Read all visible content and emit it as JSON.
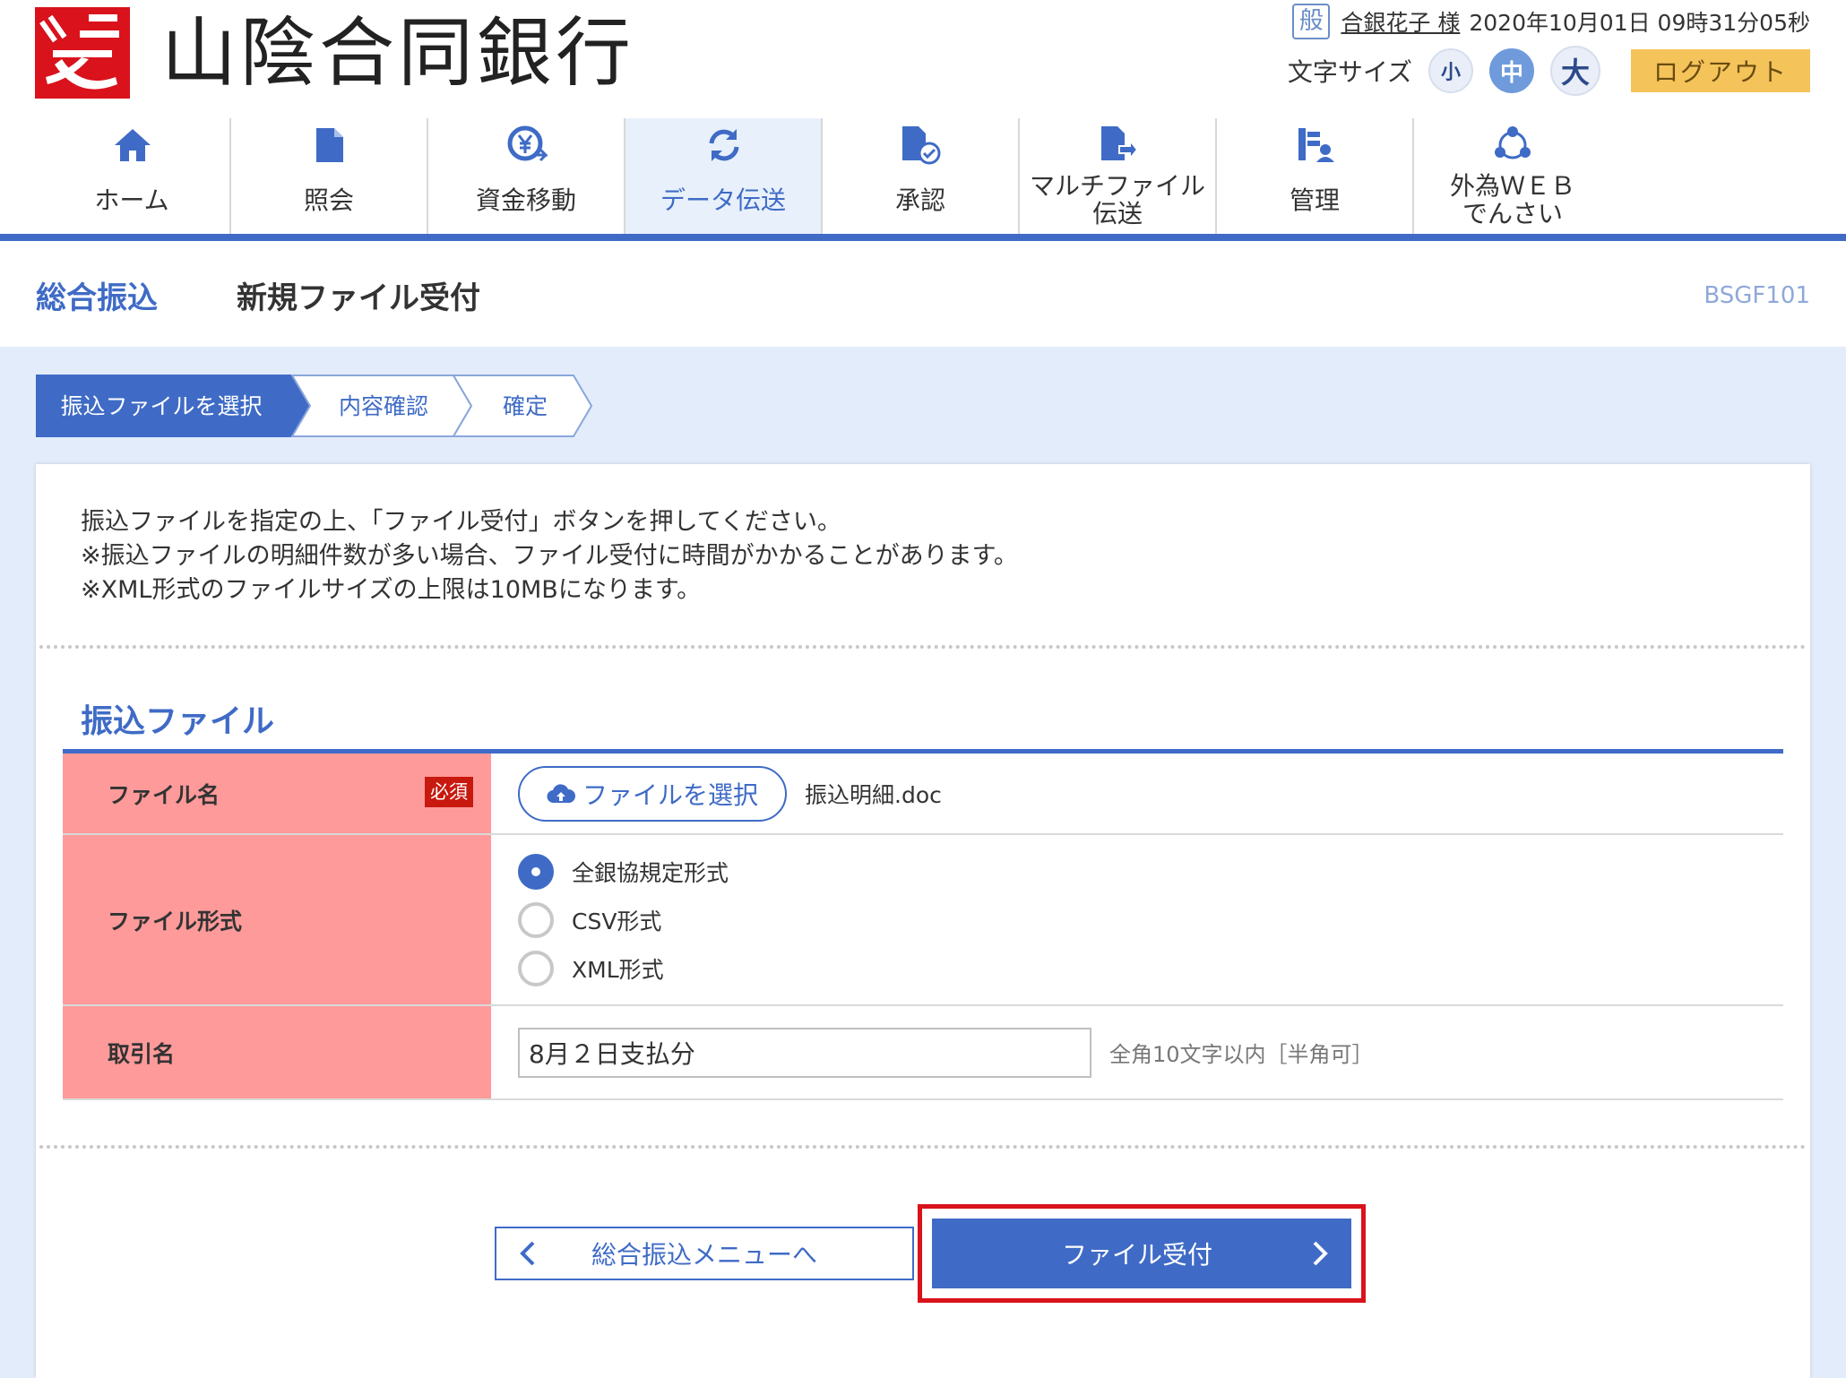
{
  "header": {
    "bank_name": "山陰合同銀行",
    "user_badge": "般",
    "user_name": "合銀花子 様",
    "datetime": "2020年10月01日 09時31分05秒",
    "font_size_label": "文字サイズ",
    "font_sizes": {
      "small": "小",
      "medium": "中",
      "large": "大",
      "selected": "中"
    },
    "logout_label": "ログアウト"
  },
  "nav": {
    "active": "データ伝送",
    "items": [
      {
        "label": "ホーム",
        "icon": "home-icon"
      },
      {
        "label": "照会",
        "icon": "document-icon"
      },
      {
        "label": "資金移動",
        "icon": "yen-transfer-icon"
      },
      {
        "label": "データ伝送",
        "icon": "sync-icon"
      },
      {
        "label": "承認",
        "icon": "approve-icon"
      },
      {
        "label": "マルチファイル\n伝送",
        "icon": "multi-file-icon"
      },
      {
        "label": "管理",
        "icon": "admin-icon"
      },
      {
        "label": "外為ＷＥＢ\nでんさい",
        "icon": "network-icon"
      }
    ]
  },
  "page": {
    "section_title": "総合振込",
    "title": "新規ファイル受付",
    "screen_id": "BSGF101"
  },
  "steps": [
    {
      "label": "振込ファイルを選択",
      "active": true
    },
    {
      "label": "内容確認",
      "active": false
    },
    {
      "label": "確定",
      "active": false
    }
  ],
  "instructions": [
    "振込ファイルを指定の上、「ファイル受付」ボタンを押してください。",
    "※振込ファイルの明細件数が多い場合、ファイル受付に時間がかかることがあります。",
    "※XML形式のファイルサイズの上限は10MBになります。"
  ],
  "form": {
    "heading": "振込ファイル",
    "file_name": {
      "label": "ファイル名",
      "required": "必須",
      "select_button": "ファイルを選択",
      "selected_file": "振込明細.doc"
    },
    "file_format": {
      "label": "ファイル形式",
      "options": [
        "全銀協規定形式",
        "CSV形式",
        "XML形式"
      ],
      "selected": "全銀協規定形式"
    },
    "trade_name": {
      "label": "取引名",
      "value": "8月２日支払分",
      "hint": "全角10文字以内［半角可］"
    }
  },
  "buttons": {
    "back": "総合振込メニューへ",
    "submit": "ファイル受付"
  },
  "colors": {
    "accent": "#3f6bc6",
    "label_bg": "#ff9a9a",
    "required_badge": "#c8190f",
    "logout_bg": "#f4c45a",
    "highlight": "#d9121b"
  }
}
